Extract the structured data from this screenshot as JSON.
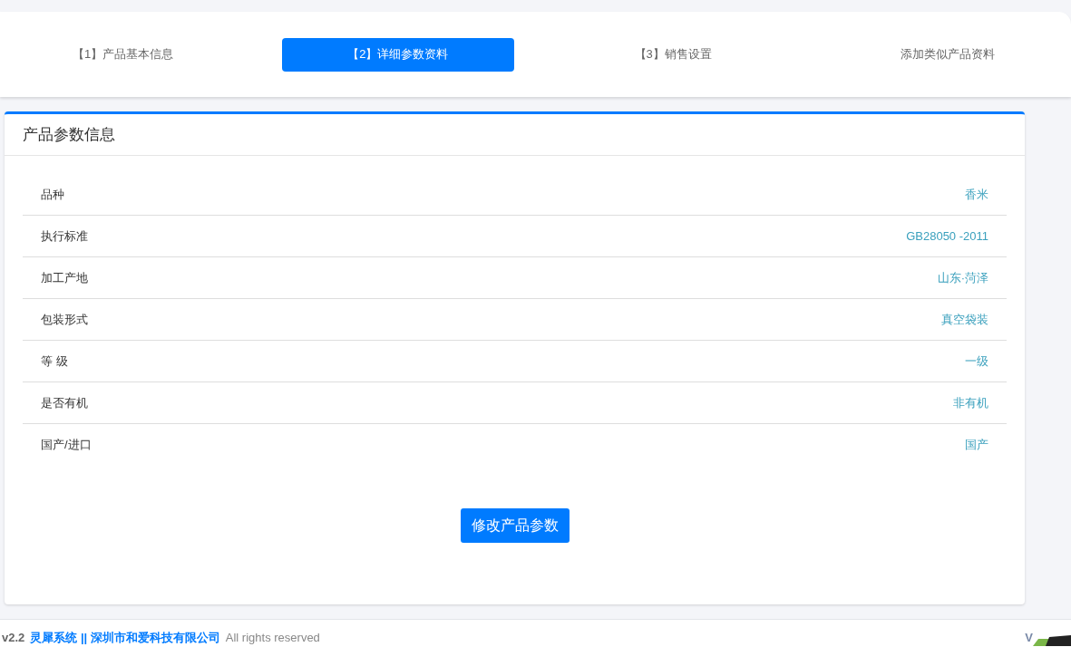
{
  "steps": [
    {
      "label": "【1】产品基本信息",
      "selected": false
    },
    {
      "label": "【2】详细参数资料",
      "selected": true
    },
    {
      "label": "【3】销售设置",
      "selected": false
    },
    {
      "label": "添加类似产品资料",
      "selected": false
    }
  ],
  "card": {
    "title": "产品参数信息",
    "params": [
      {
        "name": "品种",
        "value": "香米"
      },
      {
        "name": "执行标准",
        "value": "GB28050 -2011"
      },
      {
        "name": "加工产地",
        "value": "山东·菏泽"
      },
      {
        "name": "包装形式",
        "value": "真空袋装"
      },
      {
        "name": "等 级",
        "value": "一级"
      },
      {
        "name": "是否有机",
        "value": "非有机"
      },
      {
        "name": "国产/进口",
        "value": "国产"
      }
    ],
    "button": "修改产品参数"
  },
  "footer": {
    "version": "v2.2",
    "company": "灵犀系统 || 深圳市和爱科技有限公司",
    "rights": "All rights reserved",
    "right_text": "V"
  }
}
